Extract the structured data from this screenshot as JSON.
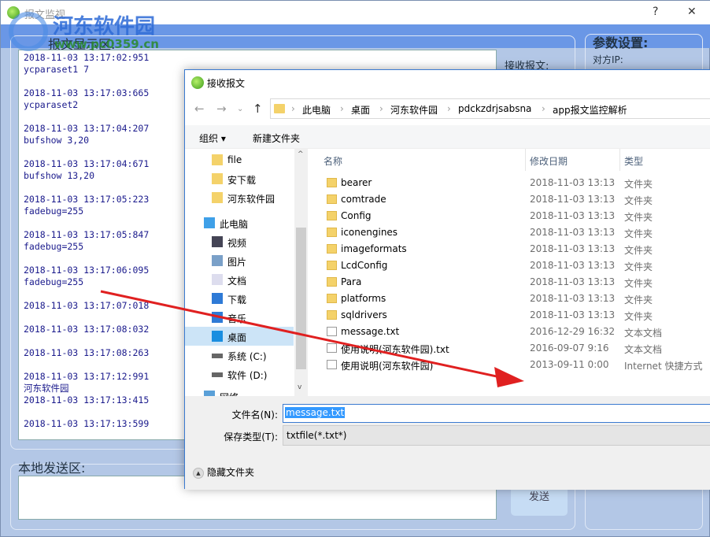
{
  "main": {
    "title": "报文监视",
    "watermark": "河东软件园",
    "watermark_url": "www.pc0359.cn",
    "help": "?",
    "close": "✕",
    "display_label": "报文显示区:",
    "recv_label": "接收报文:",
    "params_label": "参数设置:",
    "peer_ip_label": "对方IP:",
    "send_label": "本地发送区:",
    "send_button": "发送",
    "log": [
      "2018-11-03 13:17:02:951",
      "ycparaset1 7",
      "",
      "2018-11-03 13:17:03:665",
      "ycparaset2",
      "",
      "2018-11-03 13:17:04:207",
      "bufshow 3,20",
      "",
      "2018-11-03 13:17:04:671",
      "bufshow 13,20",
      "",
      "2018-11-03 13:17:05:223",
      "fadebug=255",
      "",
      "2018-11-03 13:17:05:847",
      "fadebug=255",
      "",
      "2018-11-03 13:17:06:095",
      "fadebug=255",
      "",
      "2018-11-03 13:17:07:018",
      "",
      "2018-11-03 13:17:08:032",
      "",
      "2018-11-03 13:17:08:263",
      "",
      "2018-11-03 13:17:12:991",
      "河东软件园",
      "2018-11-03 13:17:13:415",
      "",
      "2018-11-03 13:17:13:599"
    ]
  },
  "dialog": {
    "title": "接收报文",
    "breadcrumb": [
      "此电脑",
      "桌面",
      "河东软件园",
      "pdckzdrjsabsna",
      "app报文监控解析"
    ],
    "organize": "组织 ▾",
    "new_folder": "新建文件夹",
    "nav": [
      {
        "label": "file",
        "icon": "folder-icon"
      },
      {
        "label": "安下载",
        "icon": "folder-icon"
      },
      {
        "label": "河东软件园",
        "icon": "folder-icon"
      },
      {
        "label": "此电脑",
        "icon": "computer-icon"
      },
      {
        "label": "视频",
        "icon": "video-icon"
      },
      {
        "label": "图片",
        "icon": "picture-icon"
      },
      {
        "label": "文档",
        "icon": "document-icon"
      },
      {
        "label": "下载",
        "icon": "download-icon"
      },
      {
        "label": "音乐",
        "icon": "music-icon"
      },
      {
        "label": "桌面",
        "icon": "desktop-icon",
        "selected": true
      },
      {
        "label": "系统 (C:)",
        "icon": "drive-icon"
      },
      {
        "label": "软件 (D:)",
        "icon": "drive-icon"
      },
      {
        "label": "网络",
        "icon": "network-icon"
      }
    ],
    "columns": [
      "名称",
      "修改日期",
      "类型"
    ],
    "files": [
      {
        "name": "bearer",
        "date": "2018-11-03 13:13",
        "type": "文件夹",
        "icon": "folder-icon"
      },
      {
        "name": "comtrade",
        "date": "2018-11-03 13:13",
        "type": "文件夹",
        "icon": "folder-icon"
      },
      {
        "name": "Config",
        "date": "2018-11-03 13:13",
        "type": "文件夹",
        "icon": "folder-icon"
      },
      {
        "name": "iconengines",
        "date": "2018-11-03 13:13",
        "type": "文件夹",
        "icon": "folder-icon"
      },
      {
        "name": "imageformats",
        "date": "2018-11-03 13:13",
        "type": "文件夹",
        "icon": "folder-icon"
      },
      {
        "name": "LcdConfig",
        "date": "2018-11-03 13:13",
        "type": "文件夹",
        "icon": "folder-icon"
      },
      {
        "name": "Para",
        "date": "2018-11-03 13:13",
        "type": "文件夹",
        "icon": "folder-icon"
      },
      {
        "name": "platforms",
        "date": "2018-11-03 13:13",
        "type": "文件夹",
        "icon": "folder-icon"
      },
      {
        "name": "sqldrivers",
        "date": "2018-11-03 13:13",
        "type": "文件夹",
        "icon": "folder-icon"
      },
      {
        "name": "message.txt",
        "date": "2016-12-29 16:32",
        "type": "文本文档",
        "icon": "text-file-icon"
      },
      {
        "name": "使用说明(河东软件园).txt",
        "date": "2016-09-07 9:16",
        "type": "文本文档",
        "icon": "text-file-icon"
      },
      {
        "name": "使用说明(河东软件园)",
        "date": "2013-09-11 0:00",
        "type": "Internet 快捷方式",
        "icon": "shortcut-icon"
      }
    ],
    "filename_label": "文件名(N):",
    "filename_value": "message.txt",
    "filetype_label": "保存类型(T):",
    "filetype_value": "txtfile(*.txt*)",
    "hide_folders": "隐藏文件夹"
  }
}
